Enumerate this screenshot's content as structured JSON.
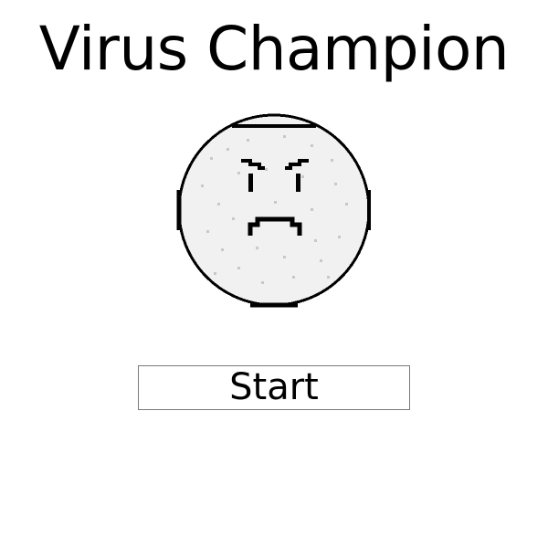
{
  "game": {
    "title": "Virus Champion",
    "start_label": "Start"
  },
  "colors": {
    "background": "#ffffff",
    "text": "#000000",
    "face_fill": "#f1f1f1",
    "face_outline": "#000000",
    "speckle": "#c8c8c8",
    "button_border": "#7a7a7a"
  },
  "icons": {
    "mascot": "angry-virus-face-icon"
  }
}
